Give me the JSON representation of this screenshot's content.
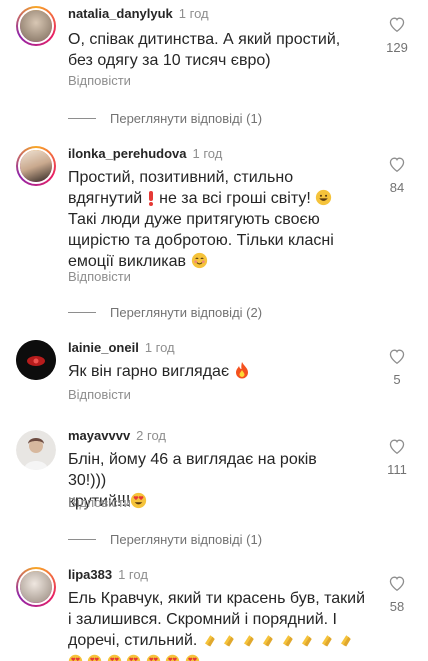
{
  "comments": [
    {
      "username": "natalia_danylyuk",
      "time": "1 год",
      "text": "О, співак дитинства. А який простий, без одягу за 10 тисяч євро)",
      "reply": "Відповісти",
      "likes": "129",
      "view_replies": "Переглянути відповіді (1)"
    },
    {
      "username": "ilonka_perehudova",
      "time": "1 год",
      "text_1": "Простий, позитивний, стильно вдягнутий",
      "text_2": "не за всі гроші світу!",
      "text_3": "Такі люди дуже притягують своєю щирістю та добротою. Тільки класні емоції викликав",
      "reply": "Відповісти",
      "likes": "84",
      "view_replies": "Переглянути відповіді (2)"
    },
    {
      "username": "lainie_oneil",
      "time": "1 год",
      "text": "Як він гарно виглядає",
      "reply": "Відповісти",
      "likes": "5"
    },
    {
      "username": "mayavvvv",
      "time": "2 год",
      "text_1": "Блін, йому 46 а виглядає на років 30!)))",
      "text_2": "крутий!!!",
      "reply": "Відповісти",
      "likes": "111",
      "view_replies": "Переглянути відповіді (1)"
    },
    {
      "username": "lipa383",
      "time": "1 год",
      "text": "Ель Кравчук, який ти красень був, такий і залишився. Скромний і порядний. І доречі, стильний.",
      "likes": "58"
    }
  ],
  "icons": {
    "heart": "heart-outline-icon",
    "fire": "fire-emoji",
    "heart_eyes": "heart-eyes-emoji",
    "clap": "clapping-hands-emoji",
    "smile": "grinning-emoji",
    "blush": "blush-emoji",
    "exclamation": "red-exclamation-emoji"
  },
  "colors": {
    "text": "#262626",
    "muted": "#8e8e8e",
    "emoji_yellow": "#f5c33b",
    "emoji_red": "#e53935"
  }
}
